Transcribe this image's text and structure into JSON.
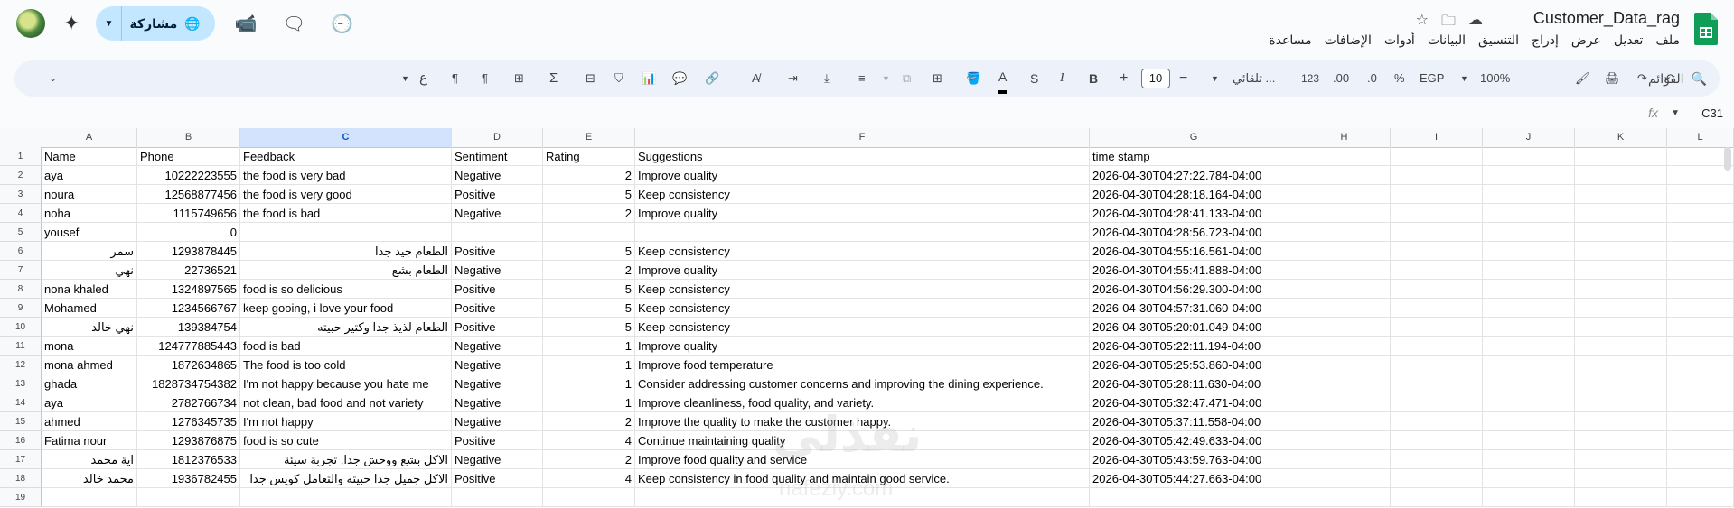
{
  "title_bar": {
    "document_title": "Customer_Data_rag",
    "share_label": "مشاركة",
    "menu": [
      "ملف",
      "تعديل",
      "عرض",
      "إدراج",
      "التنسيق",
      "البيانات",
      "أدوات",
      "الإضافات",
      "مساعدة"
    ]
  },
  "toolbar": {
    "search_label": "القوائم",
    "zoom": "100%",
    "currency": "EGP",
    "percent": "%",
    "decimal_decrease": ".0",
    "decimal_increase": ".00",
    "number_format": "123",
    "font_name": "تلقائي ...",
    "font_size": "10",
    "bold": "B",
    "italic": "I",
    "text_color_letter": "A"
  },
  "formula_bar": {
    "name_box": "C31",
    "fx": "fx"
  },
  "sheet": {
    "selected_column": "C",
    "columns": [
      "A",
      "B",
      "C",
      "D",
      "E",
      "F",
      "G",
      "H",
      "I",
      "J",
      "K",
      "L"
    ],
    "row_numbers": [
      "1",
      "2",
      "3",
      "4",
      "5",
      "6",
      "7",
      "8",
      "9",
      "10",
      "11",
      "12",
      "13",
      "14",
      "15",
      "16",
      "17",
      "18",
      "19"
    ],
    "rows": [
      [
        "Name",
        "Phone",
        "Feedback",
        "Sentiment",
        "Rating",
        "Suggestions",
        "time stamp"
      ],
      [
        "aya",
        "10222223555",
        "the food is very bad",
        "Negative",
        "2",
        "Improve quality",
        "2026-04-30T04:27:22.784-04:00"
      ],
      [
        "noura",
        "12568877456",
        "the food is very good",
        "Positive",
        "5",
        "Keep consistency",
        "2026-04-30T04:28:18.164-04:00"
      ],
      [
        "noha",
        "1115749656",
        "the food is bad",
        "Negative",
        "2",
        "Improve quality",
        "2026-04-30T04:28:41.133-04:00"
      ],
      [
        "yousef",
        "0",
        "",
        "",
        "",
        "",
        "2026-04-30T04:28:56.723-04:00"
      ],
      [
        "سمر",
        "1293878445",
        "الطعام جيد جدا",
        "Positive",
        "5",
        "Keep consistency",
        "2026-04-30T04:55:16.561-04:00"
      ],
      [
        "نهي",
        "22736521",
        "الطعام بشع",
        "Negative",
        "2",
        "Improve quality",
        "2026-04-30T04:55:41.888-04:00"
      ],
      [
        "nona khaled",
        "1324897565",
        "food is so delicious",
        "Positive",
        "5",
        "Keep consistency",
        "2026-04-30T04:56:29.300-04:00"
      ],
      [
        "Mohamed",
        "1234566767",
        "keep gooing, i love your food",
        "Positive",
        "5",
        "Keep consistency",
        "2026-04-30T04:57:31.060-04:00"
      ],
      [
        "نهي خالد",
        "139384754",
        "الطعام لذيذ جدا وكتير حبيته",
        "Positive",
        "5",
        "Keep consistency",
        "2026-04-30T05:20:01.049-04:00"
      ],
      [
        "mona",
        "124777885443",
        "food is bad",
        "Negative",
        "1",
        "Improve quality",
        "2026-04-30T05:22:11.194-04:00"
      ],
      [
        "mona ahmed",
        "1872634865",
        "The food is too cold",
        "Negative",
        "1",
        "Improve food temperature",
        "2026-04-30T05:25:53.860-04:00"
      ],
      [
        "ghada",
        "1828734754382",
        "I'm not happy because you hate me",
        "Negative",
        "1",
        "Consider addressing customer concerns and improving the dining experience.",
        "2026-04-30T05:28:11.630-04:00"
      ],
      [
        "aya",
        "2782766734",
        "not clean, bad food and not variety",
        "Negative",
        "1",
        "Improve cleanliness, food quality, and variety.",
        "2026-04-30T05:32:47.471-04:00"
      ],
      [
        "ahmed",
        "1276345735",
        "I'm not happy",
        "Negative",
        "2",
        "Improve the quality to make the customer happy.",
        "2026-04-30T05:37:11.558-04:00"
      ],
      [
        "Fatima nour",
        "1293876875",
        "food is so cute",
        "Positive",
        "4",
        "Continue maintaining quality",
        "2026-04-30T05:42:49.633-04:00"
      ],
      [
        "اية محمد",
        "1812376533",
        "الاكل بشع ووحش جدا, تجربة سيئة",
        "Negative",
        "2",
        "Improve food quality and service",
        "2026-04-30T05:43:59.763-04:00"
      ],
      [
        "محمد خالد",
        "1936782455",
        "الاكل جميل جدا حبيته والتعامل كويس جدا",
        "Positive",
        "4",
        "Keep consistency in food quality and maintain good service.",
        "2026-04-30T05:44:27.663-04:00"
      ],
      [
        "",
        "",
        "",
        "",
        "",
        "",
        ""
      ]
    ]
  },
  "watermark": {
    "line1": "نفذلي",
    "line2": "nafezly.com"
  }
}
